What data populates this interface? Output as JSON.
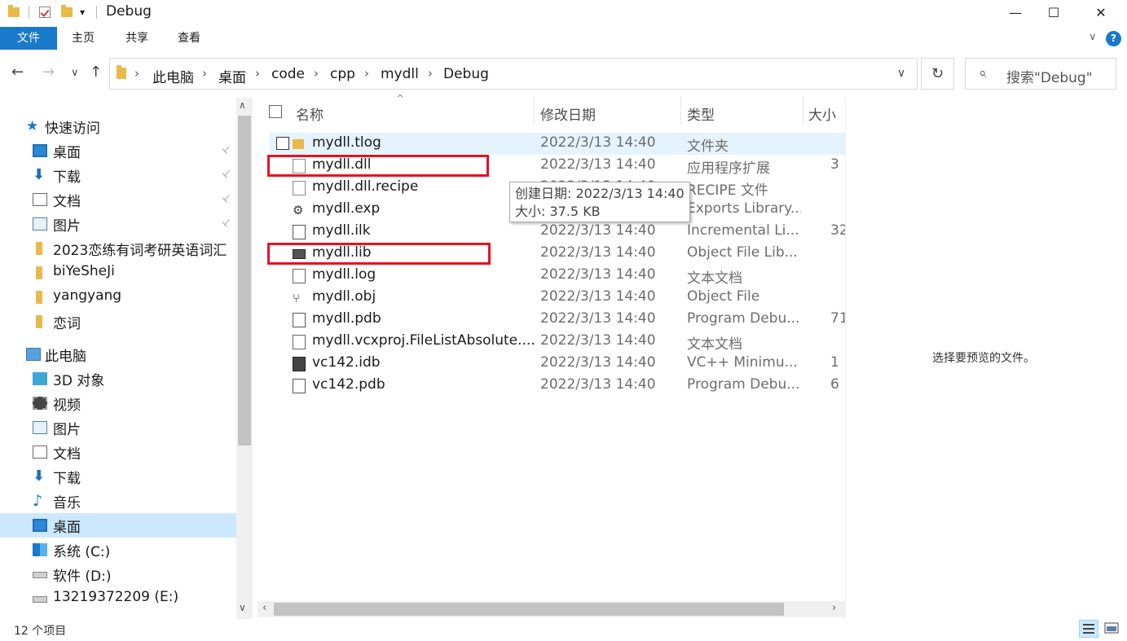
{
  "window": {
    "title": "Debug",
    "minimize": "—",
    "maximize": "☐",
    "close": "✕",
    "qa_dropdown": "▾"
  },
  "ribbon": {
    "tabs": [
      "文件",
      "主页",
      "共享",
      "查看"
    ],
    "expand": "∨",
    "help": "?"
  },
  "nav": {
    "back": "←",
    "forward": "→",
    "recent": "∨",
    "up": "↑",
    "breadcrumb": [
      "此电脑",
      "桌面",
      "code",
      "cpp",
      "mydll",
      "Debug"
    ],
    "crumb_sep": "›",
    "dropdown": "∨",
    "refresh": "↻",
    "search_placeholder": "搜索\"Debug\"",
    "search_icon": "⌕"
  },
  "sidebar": {
    "items": [
      {
        "label": "快速访问",
        "icon": "star-icon",
        "group": true,
        "pinned": false
      },
      {
        "label": "桌面",
        "icon": "desktop-icon",
        "group": false,
        "pinned": true
      },
      {
        "label": "下载",
        "icon": "download-icon",
        "group": false,
        "pinned": true
      },
      {
        "label": "文档",
        "icon": "documents-icon",
        "group": false,
        "pinned": true
      },
      {
        "label": "图片",
        "icon": "pictures-icon",
        "group": false,
        "pinned": true
      },
      {
        "label": "2023恋练有词考研英语词汇",
        "icon": "folder-icon",
        "group": false,
        "pinned": false
      },
      {
        "label": "biYeSheJi",
        "icon": "folder-icon",
        "group": false,
        "pinned": false
      },
      {
        "label": "yangyang",
        "icon": "folder-icon",
        "group": false,
        "pinned": false
      },
      {
        "label": "恋词",
        "icon": "folder-icon",
        "group": false,
        "pinned": false
      },
      {
        "label": "此电脑",
        "icon": "this-pc-icon",
        "group": true,
        "pinned": false
      },
      {
        "label": "3D 对象",
        "icon": "3d-objects-icon",
        "group": false,
        "pinned": false
      },
      {
        "label": "视频",
        "icon": "videos-icon",
        "group": false,
        "pinned": false
      },
      {
        "label": "图片",
        "icon": "pictures-icon",
        "group": false,
        "pinned": false
      },
      {
        "label": "文档",
        "icon": "documents-icon",
        "group": false,
        "pinned": false
      },
      {
        "label": "下载",
        "icon": "download-icon",
        "group": false,
        "pinned": false
      },
      {
        "label": "音乐",
        "icon": "music-icon",
        "group": false,
        "pinned": false
      },
      {
        "label": "桌面",
        "icon": "desktop-icon",
        "group": false,
        "pinned": false,
        "selected": true
      },
      {
        "label": "系统 (C:)",
        "icon": "windows-drive-icon",
        "group": false,
        "pinned": false
      },
      {
        "label": "软件 (D:)",
        "icon": "drive-icon",
        "group": false,
        "pinned": false
      },
      {
        "label": "13219372209 (E:)",
        "icon": "drive-icon",
        "group": false,
        "pinned": false
      }
    ],
    "pin_glyph": "📌",
    "scroll_up": "∧",
    "scroll_down": "∨"
  },
  "columns": {
    "name": "名称",
    "date": "修改日期",
    "type": "类型",
    "size": "大小",
    "sort_indicator": "^"
  },
  "files": [
    {
      "name": "mydll.tlog",
      "date": "2022/3/13 14:40",
      "type": "文件夹",
      "size": "",
      "icon": "folder-icon"
    },
    {
      "name": "mydll.dll",
      "date": "2022/3/13 14:40",
      "type": "应用程序扩展",
      "size": "3",
      "icon": "dll-icon"
    },
    {
      "name": "mydll.dll.recipe",
      "date": "2022/3/13 14:40",
      "type": "RECIPE 文件",
      "size": "",
      "icon": "file-icon"
    },
    {
      "name": "mydll.exp",
      "date": "2022/3/13 14:40",
      "type": "Exports Library...",
      "size": "",
      "icon": "exp-icon"
    },
    {
      "name": "mydll.ilk",
      "date": "2022/3/13 14:40",
      "type": "Incremental Li...",
      "size": "32",
      "icon": "ilk-icon"
    },
    {
      "name": "mydll.lib",
      "date": "2022/3/13 14:40",
      "type": "Object File Lib...",
      "size": "",
      "icon": "lib-icon"
    },
    {
      "name": "mydll.log",
      "date": "2022/3/13 14:40",
      "type": "文本文档",
      "size": "",
      "icon": "text-file-icon"
    },
    {
      "name": "mydll.obj",
      "date": "2022/3/13 14:40",
      "type": "Object File",
      "size": "",
      "icon": "obj-icon"
    },
    {
      "name": "mydll.pdb",
      "date": "2022/3/13 14:40",
      "type": "Program Debu...",
      "size": "71",
      "icon": "pdb-icon"
    },
    {
      "name": "mydll.vcxproj.FileListAbsolute....",
      "date": "2022/3/13 14:40",
      "type": "文本文档",
      "size": "",
      "icon": "text-file-icon"
    },
    {
      "name": "vc142.idb",
      "date": "2022/3/13 14:40",
      "type": "VC++ Minimu...",
      "size": "1",
      "icon": "idb-icon"
    },
    {
      "name": "vc142.pdb",
      "date": "2022/3/13 14:40",
      "type": "Program Debu...",
      "size": "6",
      "icon": "pdb-icon"
    }
  ],
  "tooltip": {
    "line1": "创建日期: 2022/3/13 14:40",
    "line2": "大小: 37.5 KB"
  },
  "preview": {
    "message": "选择要预览的文件。"
  },
  "hscroll": {
    "left": "‹",
    "right": "›"
  },
  "status": {
    "count": "12 个项目"
  },
  "colors": {
    "accent": "#1979ca",
    "selection": "#cce8ff",
    "hover": "#e5f3ff",
    "highlight_box": "#e81123"
  }
}
